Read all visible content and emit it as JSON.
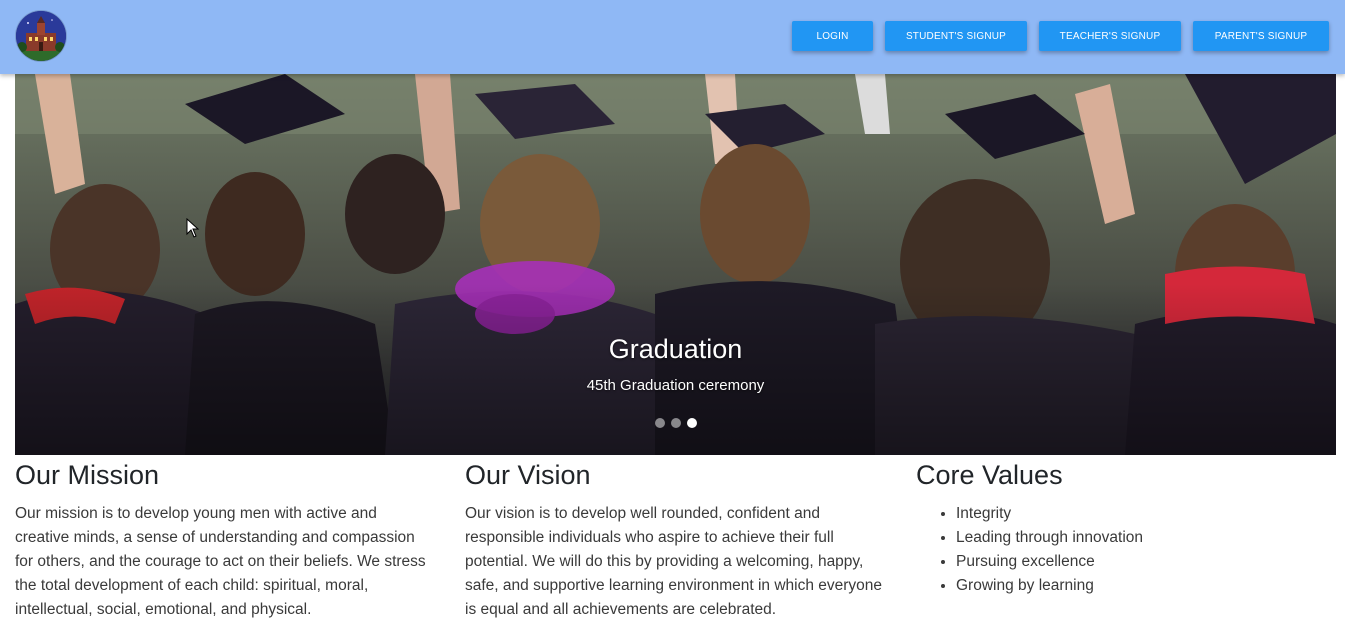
{
  "header": {
    "logo_icon": "school-building-logo",
    "buttons": {
      "login": "LOGIN",
      "student_signup": "STUDENT'S SIGNUP",
      "teacher_signup": "TEACHER'S SIGNUP",
      "parent_signup": "PARENT'S SIGNUP"
    },
    "colors": {
      "bar": "#8fb8f5",
      "button": "#2196f3"
    }
  },
  "carousel": {
    "slide_title": "Graduation",
    "slide_subtitle": "45th Graduation ceremony",
    "slide_count": 3,
    "active_index": 2
  },
  "sections": {
    "mission": {
      "title": "Our Mission",
      "body": "Our mission is to develop young men with active and creative minds, a sense of understanding and compassion for others, and the courage to act on their beliefs. We stress the total development of each child: spiritual, moral, intellectual, social, emotional, and physical."
    },
    "vision": {
      "title": "Our Vision",
      "body": "Our vision is to develop well rounded, confident and responsible individuals who aspire to achieve their full potential. We will do this by providing a welcoming, happy, safe, and supportive learning environment in which everyone is equal and all achievements are celebrated."
    },
    "values": {
      "title": "Core Values",
      "items": [
        "Integrity",
        "Leading through innovation",
        "Pursuing excellence",
        "Growing by learning"
      ]
    }
  }
}
